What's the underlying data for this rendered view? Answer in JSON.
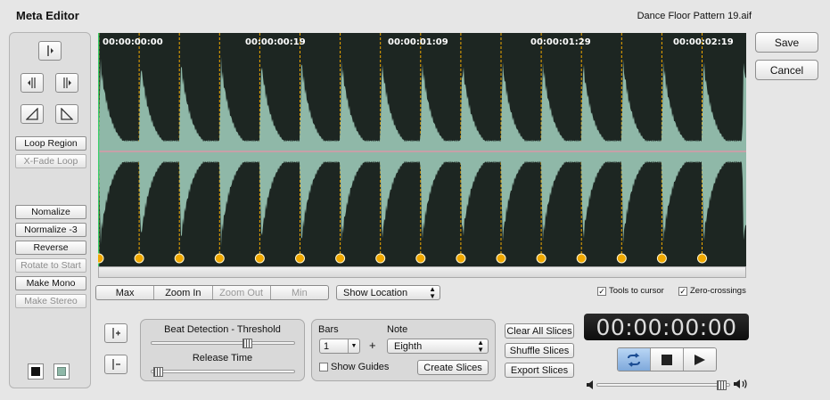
{
  "app": {
    "title": "Meta Editor",
    "filename": "Dance Floor Pattern 19.aif"
  },
  "actions": {
    "save": "Save",
    "cancel": "Cancel"
  },
  "left_panel": {
    "loop_region": "Loop Region",
    "xfade_loop": "X-Fade Loop",
    "normalize": "Nomalize",
    "normalize_3": "Normalize -3",
    "reverse": "Reverse",
    "rotate_to_start": "Rotate to Start",
    "make_mono": "Make Mono",
    "make_stereo": "Make Stereo"
  },
  "timeline": {
    "codes": [
      "00:00:00:00",
      "00:00:00:19",
      "00:00:01:09",
      "00:00:01:29",
      "00:00:02:19"
    ]
  },
  "zoom": {
    "max": "Max",
    "zoom_in": "Zoom In",
    "zoom_out": "Zoom Out",
    "min": "Min"
  },
  "show_location": "Show Location",
  "options": {
    "tools_to_cursor": "Tools to cursor",
    "zero_crossings": "Zero-crossings"
  },
  "beat": {
    "threshold_label": "Beat Detection - Threshold",
    "release_label": "Release Time",
    "threshold_value": 0.68,
    "release_value": 0.02
  },
  "slice_settings": {
    "bars_label": "Bars",
    "bars_value": "1",
    "plus": "+",
    "note_label": "Note",
    "note_value": "Eighth",
    "show_guides": "Show Guides",
    "create_slices": "Create Slices"
  },
  "slice_actions": {
    "clear_all": "Clear All Slices",
    "shuffle": "Shuffle Slices",
    "export": "Export Slices"
  },
  "time_display": "00:00:00:00",
  "volume": {
    "level": 0.97
  },
  "icons": {
    "trim_start": "trim-start-icon",
    "move_left": "move-left-icon",
    "move_right": "move-right-icon",
    "fade_in": "fade-in-icon",
    "fade_out": "fade-out-icon",
    "add_marker": "add-marker-icon",
    "remove_marker": "remove-marker-icon",
    "loop": "loop-icon",
    "stop": "stop-icon",
    "play": "play-icon",
    "speaker_low": "speaker-low-icon",
    "speaker_high": "speaker-high-icon"
  },
  "colors": {
    "waveform": "#8fb8a8",
    "waveform_bg": "#1d2622",
    "slice_marker": "#f0a800",
    "center_line": "#c8a0a8"
  }
}
